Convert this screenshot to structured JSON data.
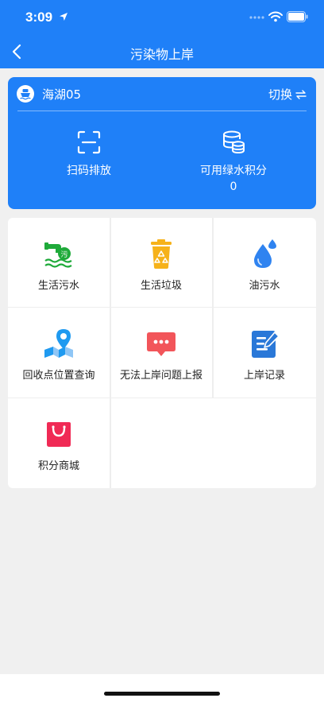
{
  "status_bar": {
    "time": "3:09"
  },
  "nav": {
    "title": "污染物上岸"
  },
  "card": {
    "ship_name": "海湖05",
    "switch_label": "切换",
    "scan_label": "扫码排放",
    "points_label": "可用绿水积分",
    "points_value": "0"
  },
  "menu": [
    {
      "label": "生活污水",
      "icon": "sewage-pipe-icon",
      "color": "#1faa3a"
    },
    {
      "label": "生活垃圾",
      "icon": "trash-bin-icon",
      "color": "#f6b21a"
    },
    {
      "label": "油污水",
      "icon": "oil-drop-icon",
      "color": "#2f83f0"
    },
    {
      "label": "回收点位置查询",
      "icon": "map-pin-icon",
      "color": "#1f9af0"
    },
    {
      "label": "无法上岸问题上报",
      "icon": "chat-report-icon",
      "color": "#f2555a"
    },
    {
      "label": "上岸记录",
      "icon": "record-edit-icon",
      "color": "#2a78d8"
    },
    {
      "label": "积分商城",
      "icon": "shopping-bag-icon",
      "color": "#f02a55"
    }
  ],
  "colors": {
    "primary": "#1f80f8",
    "background": "#f0f0f0"
  }
}
